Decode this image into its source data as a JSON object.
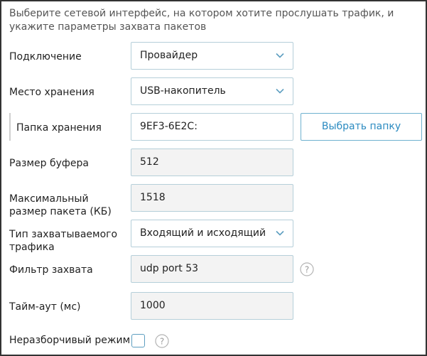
{
  "description": "Выберите сетевой интерфейс, на котором хотите прослушать трафик, и укажите параметры захвата пакетов",
  "connection": {
    "label": "Подключение",
    "value": "Провайдер"
  },
  "storage": {
    "label": "Место хранения",
    "value": "USB-накопитель"
  },
  "folder": {
    "label": "Папка хранения",
    "value": "9EF3-6E2C:",
    "button": "Выбрать папку"
  },
  "buffer": {
    "label": "Размер буфера",
    "value": "512"
  },
  "packet_size": {
    "label": "Максимальный размер пакета (КБ)",
    "value": "1518"
  },
  "traffic_type": {
    "label": "Тип захватываемого трафика",
    "value": "Входящий и исходящий"
  },
  "filter": {
    "label": "Фильтр захвата",
    "value": "udp port 53"
  },
  "timeout": {
    "label": "Тайм-аут (мс)",
    "value": "1000"
  },
  "promiscuous": {
    "label": "Неразборчивый режим",
    "checked": false
  },
  "colors": {
    "accent": "#2b8bc1",
    "border": "#b5cfd9",
    "input_bg": "#f3f3f3"
  }
}
